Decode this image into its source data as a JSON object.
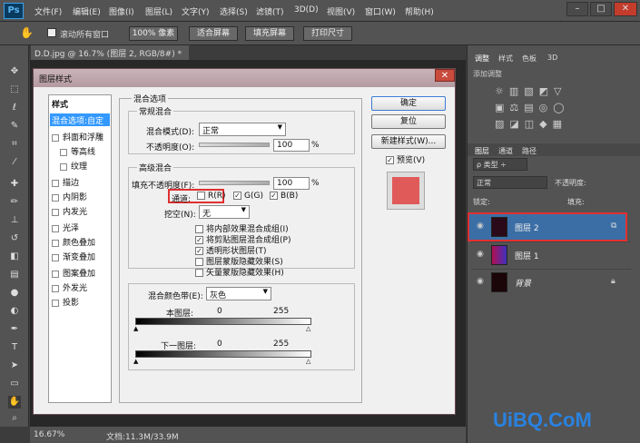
{
  "app": {
    "logo": "Ps",
    "menus": [
      "文件(F)",
      "编辑(E)",
      "图像(I)",
      "图层(L)",
      "文字(Y)",
      "选择(S)",
      "滤镜(T)",
      "3D(D)",
      "视图(V)",
      "窗口(W)",
      "帮助(H)"
    ]
  },
  "options": {
    "scroll_all": "滚动所有窗口",
    "buttons": [
      "100% 像素",
      "适合屏幕",
      "填充屏幕",
      "打印尺寸"
    ]
  },
  "document": {
    "tab": "D.D.jpg @ 16.7% (图层 2, RGB/8#) *",
    "zoom": "16.67%",
    "doc_info": "文档:11.3M/33.9M"
  },
  "right_panel": {
    "tabs_top": [
      "调整",
      "样式",
      "色板",
      "3D"
    ],
    "add_adjust": "添加调整",
    "tabs_layers": [
      "图层",
      "通道",
      "路径"
    ],
    "kind_filter": "类型",
    "blend": "正常",
    "opacity_label": "不透明度:",
    "lock_label": "锁定:",
    "fill_label": "填充:",
    "layers": [
      {
        "name": "图层 2",
        "selected": true
      },
      {
        "name": "图层 1",
        "selected": false
      },
      {
        "name": "背景",
        "selected": false
      }
    ]
  },
  "dialog": {
    "title": "图层样式",
    "styles_header": "样式",
    "style_items": [
      {
        "label": "混合选项:自定",
        "active": true
      },
      {
        "label": "斜面和浮雕",
        "cb": true
      },
      {
        "label": "等高线",
        "cb": true,
        "indent": true
      },
      {
        "label": "纹理",
        "cb": true,
        "indent": true
      },
      {
        "label": "描边",
        "cb": true
      },
      {
        "label": "内阴影",
        "cb": true
      },
      {
        "label": "内发光",
        "cb": true
      },
      {
        "label": "光泽",
        "cb": true
      },
      {
        "label": "颜色叠加",
        "cb": true
      },
      {
        "label": "渐变叠加",
        "cb": true
      },
      {
        "label": "图案叠加",
        "cb": true
      },
      {
        "label": "外发光",
        "cb": true
      },
      {
        "label": "投影",
        "cb": true
      }
    ],
    "blend_section": "混合选项",
    "general": "常规混合",
    "blend_mode_label": "混合模式(D):",
    "blend_mode": "正常",
    "opacity_label": "不透明度(O):",
    "opacity_value": "100",
    "pct": "%",
    "advanced": "高级混合",
    "fill_opacity_label": "填充不透明度(F):",
    "fill_opacity_value": "100",
    "channels_label": "通道:",
    "ch_r": "R(R)",
    "ch_g": "G(G)",
    "ch_b": "B(B)",
    "knockout_label": "挖空(N):",
    "knockout_value": "无",
    "options": [
      {
        "label": "将内部效果混合成组(I)",
        "checked": false
      },
      {
        "label": "将剪贴图层混合成组(P)",
        "checked": true
      },
      {
        "label": "透明形状图层(T)",
        "checked": true
      },
      {
        "label": "图层蒙版隐藏效果(S)",
        "checked": false
      },
      {
        "label": "矢量蒙版隐藏效果(H)",
        "checked": false
      }
    ],
    "blend_if_label": "混合颜色带(E):",
    "blend_if_value": "灰色",
    "this_layer": "本图层:",
    "under_layer": "下一图层:",
    "v0": "0",
    "v255": "255",
    "ok": "确定",
    "reset": "复位",
    "new_style": "新建样式(W)...",
    "preview": "预览(V)"
  },
  "watermark": "UiBQ.CoM",
  "colors": {
    "accent_selected": "#3b6ea5",
    "highlight_red": "#e03030",
    "preview_swatch": "#e05a5a"
  }
}
